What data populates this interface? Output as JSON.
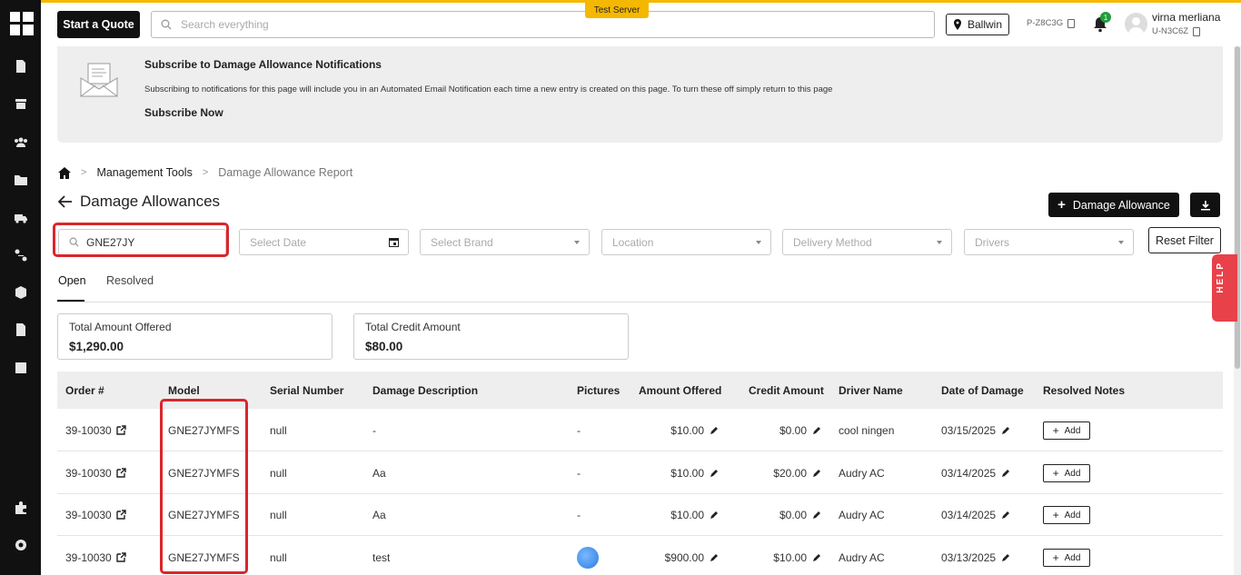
{
  "header": {
    "start_quote": "Start a Quote",
    "search_placeholder": "Search everything",
    "test_server": "Test Server",
    "location": "Ballwin",
    "profile_code": "P-Z8C3G",
    "notifications_count": "1",
    "user_name": "virna merliana",
    "user_code": "U-N3C6Z"
  },
  "banner": {
    "title": "Subscribe to Damage Allowance Notifications",
    "text": "Subscribing to notifications for this page will include you in an Automated Email Notification each time a new entry is created on this page. To turn these off simply return to this page",
    "link": "Subscribe Now"
  },
  "breadcrumb": {
    "level1": "Management Tools",
    "level2": "Damage Allowance Report"
  },
  "page": {
    "title": "Damage Allowances",
    "add_button": "Damage Allowance"
  },
  "filters": {
    "search_value": "GNE27JY",
    "date_placeholder": "Select Date",
    "brand_placeholder": "Select Brand",
    "location_placeholder": "Location",
    "delivery_placeholder": "Delivery Method",
    "drivers_placeholder": "Drivers",
    "reset": "Reset Filter"
  },
  "tabs": {
    "open": "Open",
    "resolved": "Resolved"
  },
  "summary": {
    "offered_label": "Total Amount Offered",
    "offered_value": "$1,290.00",
    "credit_label": "Total Credit Amount",
    "credit_value": "$80.00"
  },
  "table": {
    "headers": {
      "order": "Order #",
      "model": "Model",
      "serial": "Serial Number",
      "description": "Damage Description",
      "pictures": "Pictures",
      "offered": "Amount Offered",
      "credit": "Credit Amount",
      "driver": "Driver Name",
      "date": "Date of Damage",
      "notes": "Resolved Notes"
    },
    "add_label": "Add",
    "rows": [
      {
        "order": "39-10030",
        "model": "GNE27JYMFS",
        "serial": "null",
        "description": "-",
        "pictures": "-",
        "offered": "$10.00",
        "credit": "$0.00",
        "driver": "cool ningen",
        "date": "03/15/2025"
      },
      {
        "order": "39-10030",
        "model": "GNE27JYMFS",
        "serial": "null",
        "description": "Aa",
        "pictures": "-",
        "offered": "$10.00",
        "credit": "$20.00",
        "driver": "Audry AC",
        "date": "03/14/2025"
      },
      {
        "order": "39-10030",
        "model": "GNE27JYMFS",
        "serial": "null",
        "description": "Aa",
        "pictures": "-",
        "offered": "$10.00",
        "credit": "$0.00",
        "driver": "Audry AC",
        "date": "03/14/2025"
      },
      {
        "order": "39-10030",
        "model": "GNE27JYMFS",
        "serial": "null",
        "description": "test",
        "pictures": "",
        "offered": "$900.00",
        "credit": "$10.00",
        "driver": "Audry AC",
        "date": "03/13/2025"
      }
    ]
  },
  "help": "HELP",
  "colors": {
    "accent": "#f5b800",
    "highlight": "#d9262c",
    "help": "#e8414a",
    "badge": "#1f9d3c"
  }
}
